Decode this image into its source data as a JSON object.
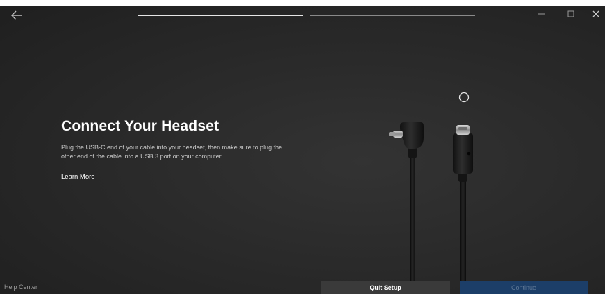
{
  "header": {
    "back_icon": "arrow-left-icon",
    "progress_steps": [
      {
        "state": "complete"
      },
      {
        "state": "incomplete"
      }
    ],
    "window_controls": [
      "minimize-icon",
      "maximize-icon",
      "close-icon"
    ]
  },
  "main": {
    "title": "Connect Your Headset",
    "description": "Plug the USB-C end of your cable into your headset, then make sure to plug the other end of the cable into a USB 3 port on your computer.",
    "learn_more": "Learn More",
    "illustration": "usb-c-cable-illustration"
  },
  "footer": {
    "help_center": "Help Center",
    "quit_label": "Quit Setup",
    "continue_label": "Continue",
    "continue_enabled": false
  },
  "colors": {
    "background": "#2b2b2b",
    "primary_button": "#1c3e68",
    "secondary_button": "#3a3a3a",
    "text_primary": "#ffffff",
    "text_secondary": "#c9c9c9"
  }
}
